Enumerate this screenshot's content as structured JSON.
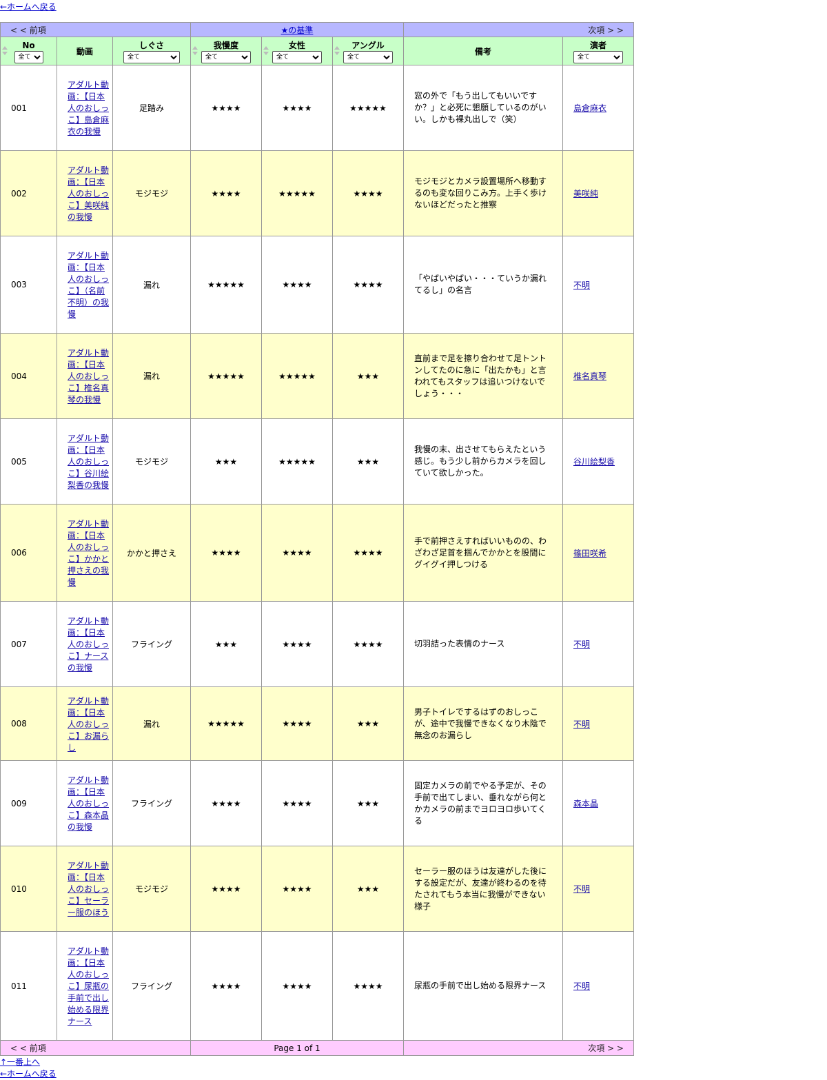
{
  "links": {
    "home": "←ホームへ戻る",
    "top": "↑一番上へ"
  },
  "nav": {
    "prev": "< < 前項",
    "next": "次項 > >",
    "criteria": "★の基準",
    "page": "Page 1 of 1"
  },
  "headers": {
    "no": "No",
    "video": "動画",
    "gesture": "しぐさ",
    "endurance": "我慢度",
    "woman": "女性",
    "angle": "アングル",
    "note": "備考",
    "actor": "演者"
  },
  "filters": {
    "no": "全て",
    "gesture": "全て",
    "endurance": "全て",
    "woman": "全て",
    "angle": "全て",
    "actor": "全て"
  },
  "rows": [
    {
      "no": "001",
      "video": "アダルト動画：【日本人のおしっこ】島倉麻衣の我慢",
      "gesture": "足踏み",
      "endurance": "★★★★",
      "woman": "★★★★",
      "angle": "★★★★★",
      "note": "窓の外で「もう出してもいいですか？」と必死に懇願しているのがいい。しかも裸丸出しで（笑）",
      "actor": "島倉麻衣"
    },
    {
      "no": "002",
      "video": "アダルト動画：【日本人のおしっこ】美咲純の我慢",
      "gesture": "モジモジ",
      "endurance": "★★★★",
      "woman": "★★★★★",
      "angle": "★★★★",
      "note": "モジモジとカメラ設置場所へ移動するのも変な回りこみ方。上手く歩けないほどだったと推察",
      "actor": "美咲純"
    },
    {
      "no": "003",
      "video": "アダルト動画：【日本人のおしっこ】（名前不明）の我慢",
      "gesture": "漏れ",
      "endurance": "★★★★★",
      "woman": "★★★★",
      "angle": "★★★★",
      "note": "「やばいやばい・・・ていうか漏れてるし」の名言",
      "actor": "不明"
    },
    {
      "no": "004",
      "video": "アダルト動画：【日本人のおしっこ】椎名真琴の我慢",
      "gesture": "漏れ",
      "endurance": "★★★★★",
      "woman": "★★★★★",
      "angle": "★★★",
      "note": "直前まで足を擦り合わせて足トントンしてたのに急に「出たかも」と言われてもスタッフは追いつけないでしょう・・・",
      "actor": "椎名真琴"
    },
    {
      "no": "005",
      "video": "アダルト動画：【日本人のおしっこ】谷川絵梨香の我慢",
      "gesture": "モジモジ",
      "endurance": "★★★",
      "woman": "★★★★★",
      "angle": "★★★",
      "note": "我慢の末、出させてもらえたという感じ。もう少し前からカメラを回していて欲しかった。",
      "actor": "谷川絵梨香"
    },
    {
      "no": "006",
      "video": "アダルト動画：【日本人のおしっこ】かかと押さえの我慢",
      "gesture": "かかと押さえ",
      "endurance": "★★★★",
      "woman": "★★★★",
      "angle": "★★★★",
      "note": "手で前押さえすればいいものの、わざわざ足首を掴んでかかとを股間にグイグイ押しつける",
      "actor": "篠田咲希"
    },
    {
      "no": "007",
      "video": "アダルト動画：【日本人のおしっこ】ナースの我慢",
      "gesture": "フライング",
      "endurance": "★★★",
      "woman": "★★★★",
      "angle": "★★★★",
      "note": "切羽詰った表情のナース",
      "actor": "不明"
    },
    {
      "no": "008",
      "video": "アダルト動画：【日本人のおしっこ】お漏らし",
      "gesture": "漏れ",
      "endurance": "★★★★★",
      "woman": "★★★★",
      "angle": "★★★",
      "note": "男子トイレでするはずのおしっこが、途中で我慢できなくなり木陰で無念のお漏らし",
      "actor": "不明"
    },
    {
      "no": "009",
      "video": "アダルト動画：【日本人のおしっこ】森本晶の我慢",
      "gesture": "フライング",
      "endurance": "★★★★",
      "woman": "★★★★",
      "angle": "★★★",
      "note": "固定カメラの前でやる予定が、その手前で出てしまい、垂れながら何とかカメラの前までヨロヨロ歩いてくる",
      "actor": "森本晶"
    },
    {
      "no": "010",
      "video": "アダルト動画：【日本人のおしっこ】セーラー服のほう",
      "gesture": "モジモジ",
      "endurance": "★★★★",
      "woman": "★★★★",
      "angle": "★★★",
      "note": "セーラー服のほうは友達がした後にする設定だが、友達が終わるのを待たされてもう本当に我慢ができない様子",
      "actor": "不明"
    },
    {
      "no": "011",
      "video": "アダルト動画：【日本人のおしっこ】尿瓶の手前で出し始める限界ナース",
      "gesture": "フライング",
      "endurance": "★★★★",
      "woman": "★★★★",
      "angle": "★★★★",
      "note": "尿瓶の手前で出し始める限界ナース",
      "actor": "不明"
    }
  ]
}
